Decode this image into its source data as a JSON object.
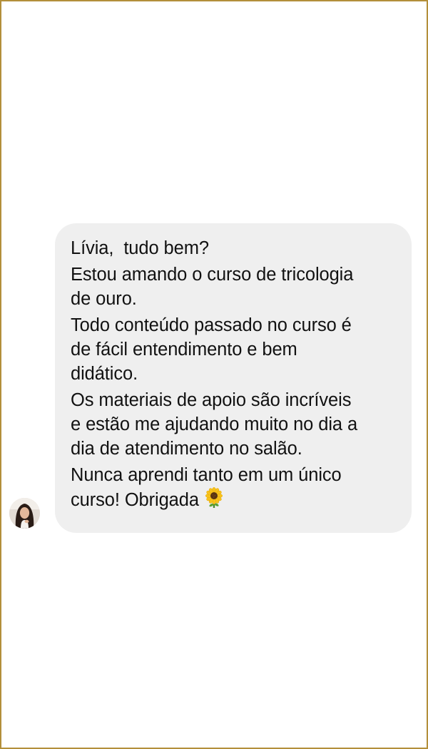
{
  "conversation": {
    "message": {
      "paragraphs": [
        "Lívia,  tudo bem?",
        "Estou amando o curso de tricologia\nde ouro.",
        "Todo conteúdo passado no curso é\nde fácil entendimento e bem\ndidático.",
        "Os materiais de apoio são incríveis\ne estão me ajudando muito no dia a\ndia de atendimento no salão.",
        "Nunca aprendi tanto em um único\ncurso! Obrigada"
      ],
      "emoji": "sunflower-icon"
    },
    "sender_avatar": "avatar-photo"
  },
  "colors": {
    "frame_border": "#b38f3a",
    "bubble_background": "#efefef",
    "text": "#111111",
    "background": "#ffffff"
  }
}
